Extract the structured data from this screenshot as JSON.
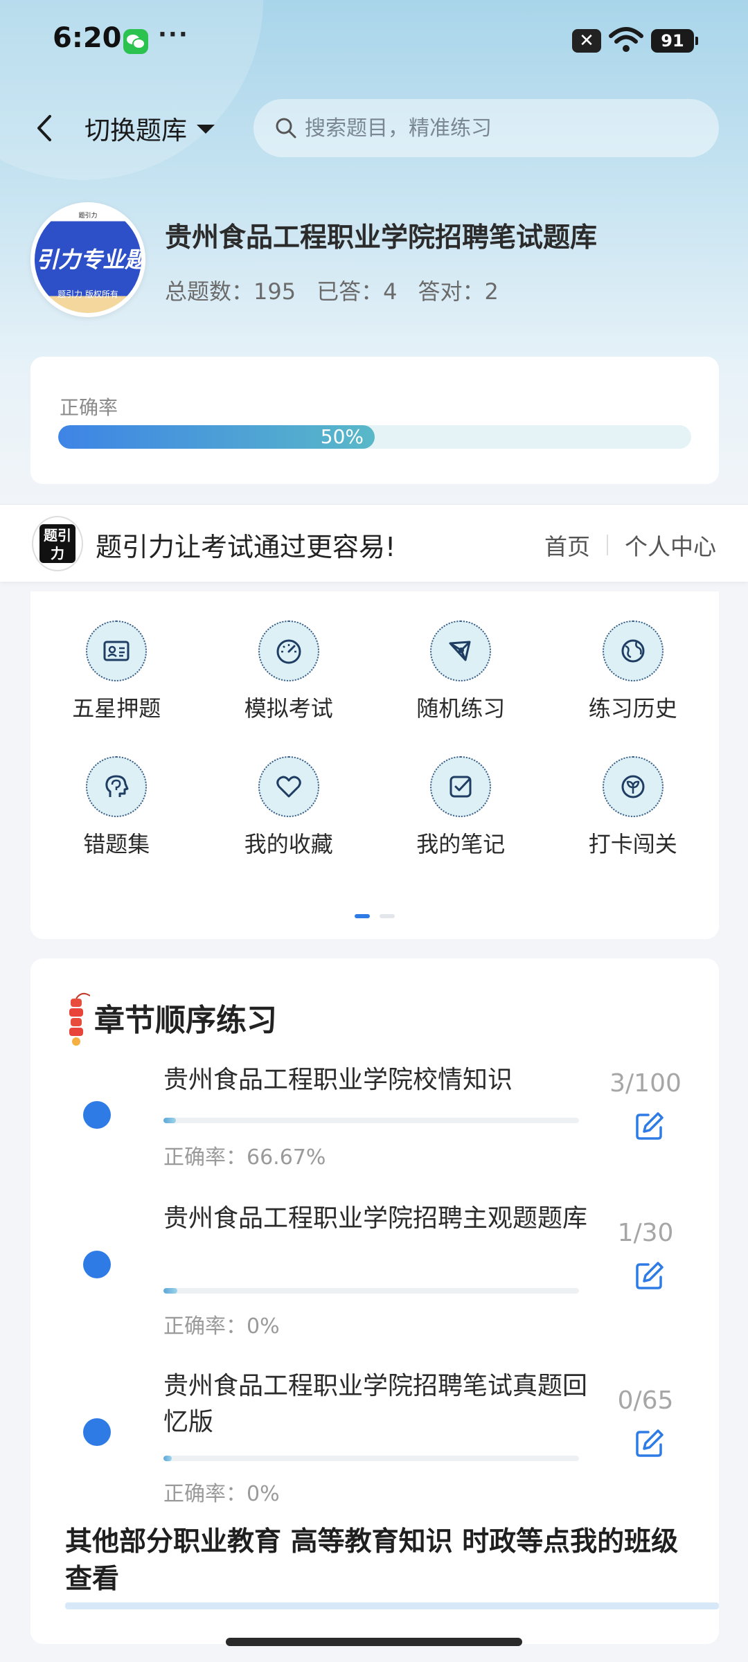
{
  "status_bar": {
    "time": "6:20",
    "more": "···",
    "battery": "91"
  },
  "nav": {
    "switch_label": "切换题库",
    "search_placeholder": "搜索题目，精准练习"
  },
  "bank": {
    "title": "贵州食品工程职业学院招聘笔试题库",
    "logo_text": "引力专业题",
    "logo_sub": "题引力 版权所有",
    "logo_top": "题引力",
    "stats": {
      "total_label": "总题数：195",
      "answered_label": "已答：4",
      "correct_label": "答对：2"
    }
  },
  "accuracy": {
    "label": "正确率",
    "value": "50%",
    "fraction": 0.5
  },
  "banner": {
    "logo_glyph": "题引力",
    "slogan": "题引力让考试通过更容易!",
    "links": [
      "首页",
      "个人中心"
    ]
  },
  "features": [
    {
      "label": "五星押题",
      "icon": "id-card-icon"
    },
    {
      "label": "模拟考试",
      "icon": "gauge-icon"
    },
    {
      "label": "随机练习",
      "icon": "network-icon"
    },
    {
      "label": "练习历史",
      "icon": "globe-icon"
    },
    {
      "label": "错题集",
      "icon": "brain-head-icon"
    },
    {
      "label": "我的收藏",
      "icon": "heart-icon"
    },
    {
      "label": "我的笔记",
      "icon": "checkbox-note-icon"
    },
    {
      "label": "打卡闯关",
      "icon": "sprout-icon"
    }
  ],
  "chapters": {
    "title": "章节顺序练习",
    "items": [
      {
        "name": "贵州食品工程职业学院校情知识",
        "accuracy": "正确率：66.67%",
        "count": "3/100",
        "progress": 0.03
      },
      {
        "name": "贵州食品工程职业学院招聘主观题题库",
        "accuracy": "正确率：0%",
        "count": "1/30",
        "progress": 0.033
      },
      {
        "name": "贵州食品工程职业学院招聘笔试真题回忆版",
        "accuracy": "正确率：0%",
        "count": "0/65",
        "progress": 0
      }
    ],
    "more_note": "其他部分职业教育 高等教育知识 时政等点我的班级查看"
  },
  "colors": {
    "accent": "#2f7be6",
    "icon_bg": "#dcf0f5",
    "icon_stroke": "#1f3d63"
  }
}
